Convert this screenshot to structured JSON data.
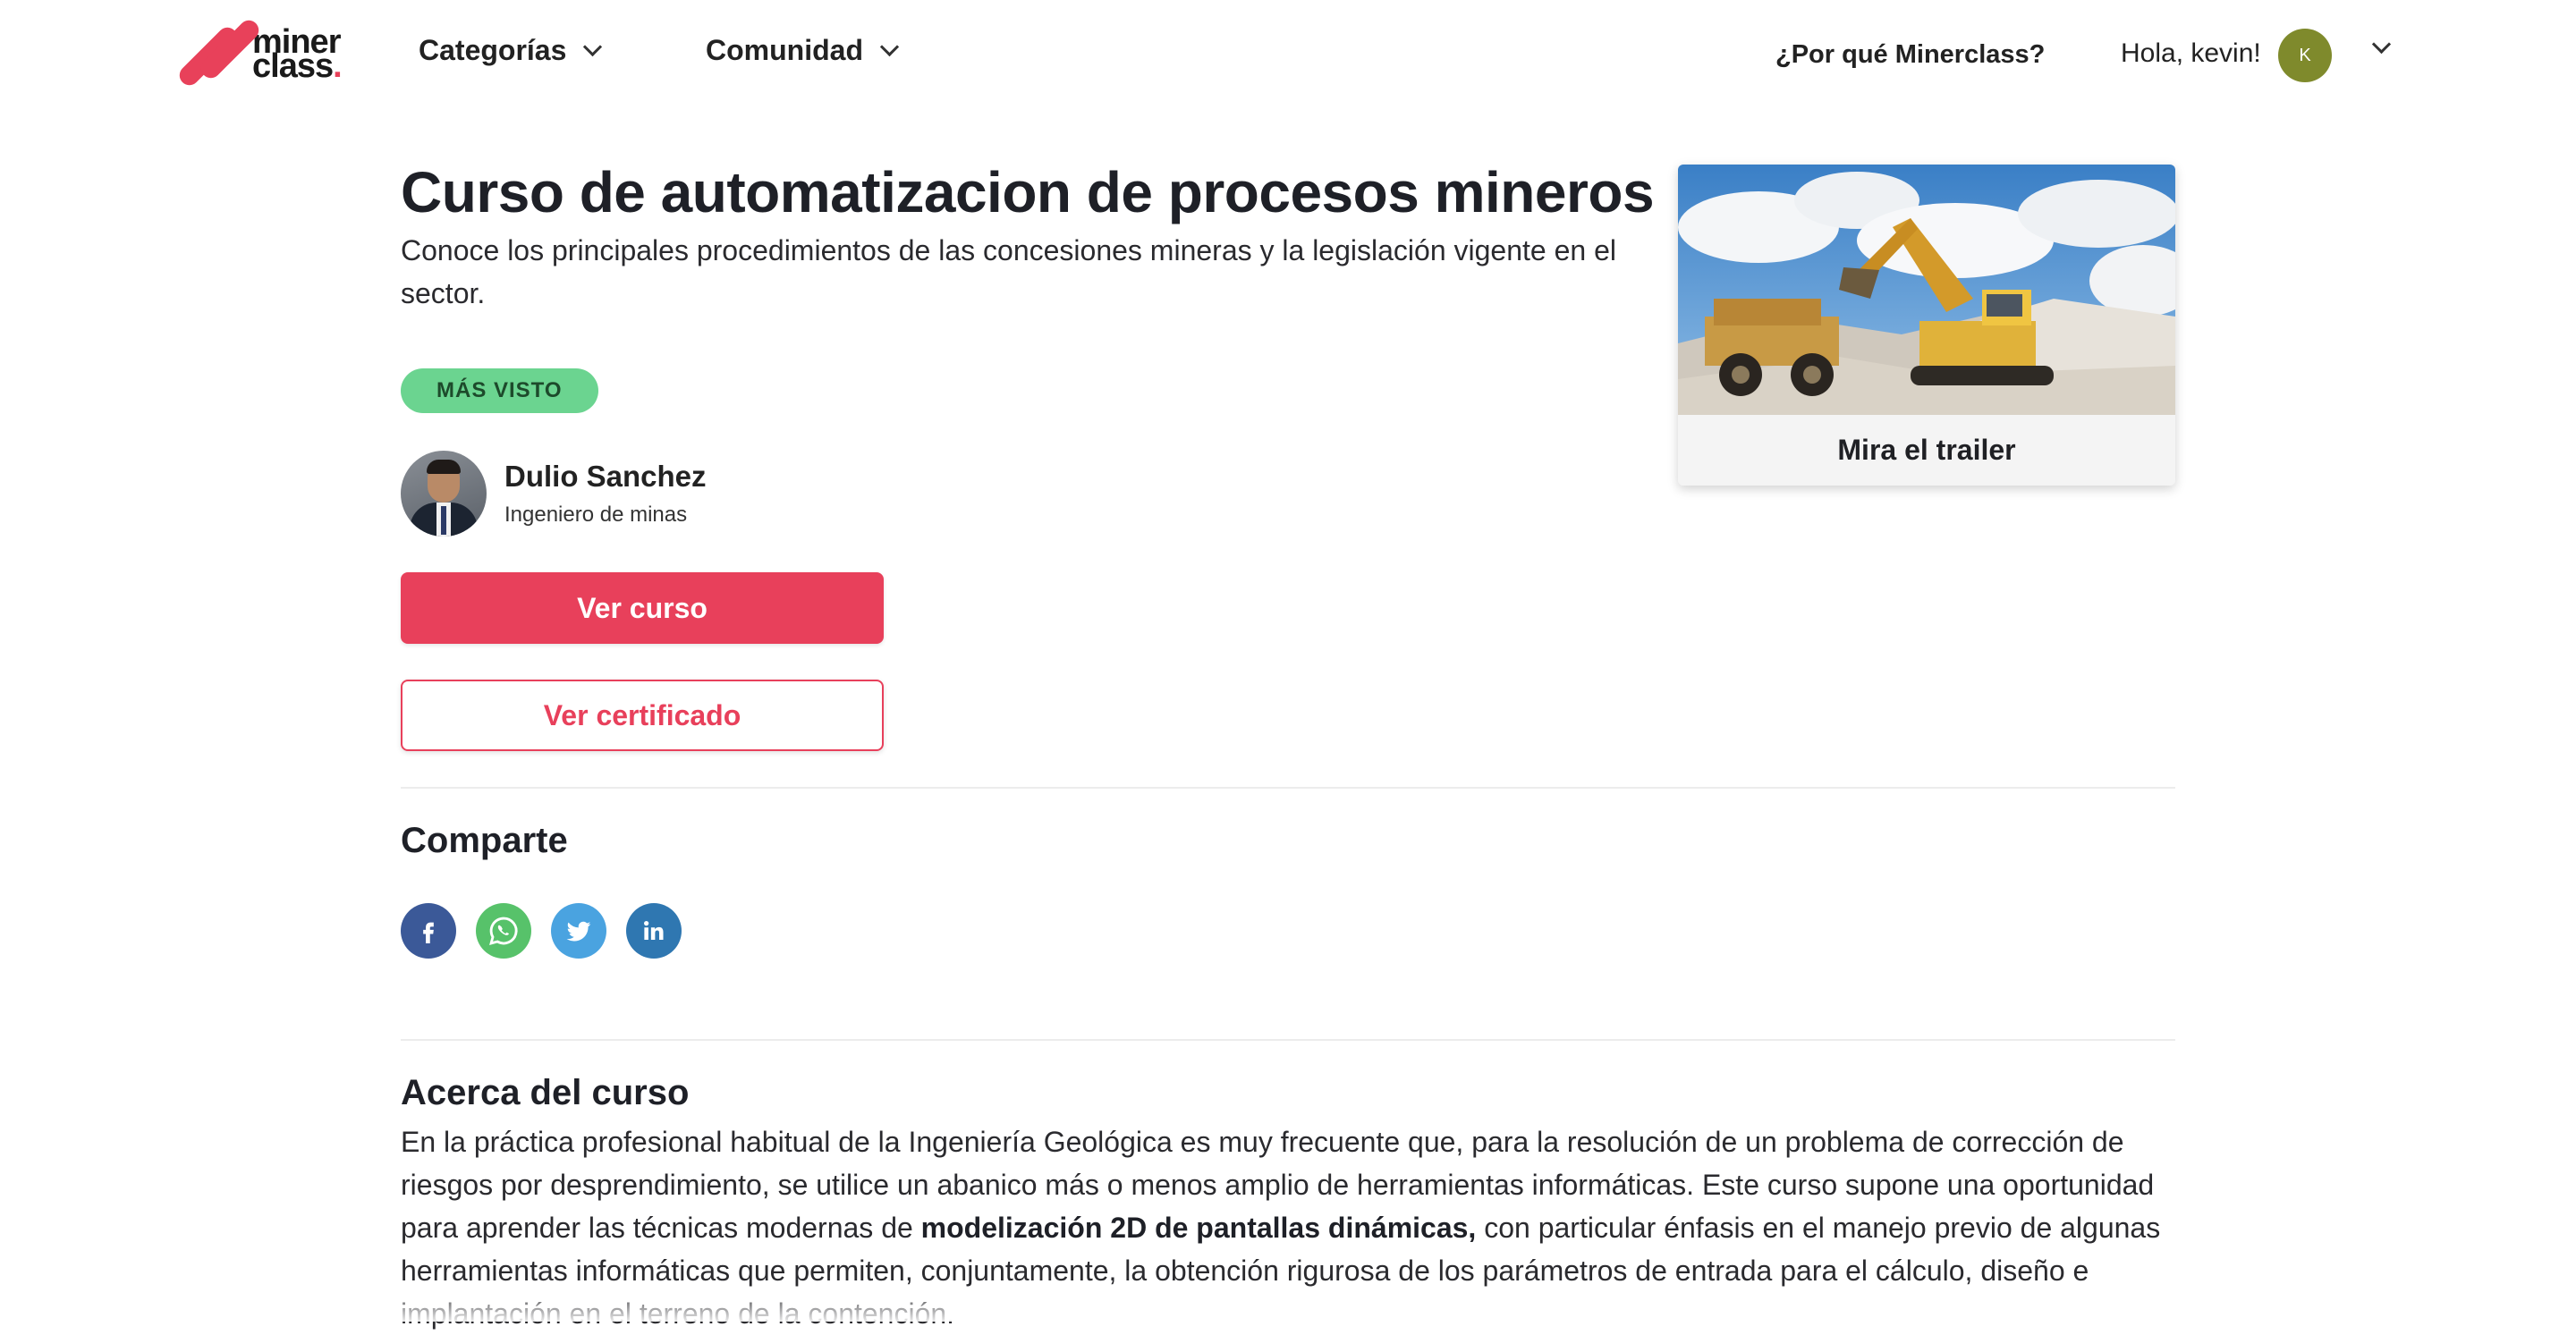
{
  "brand": {
    "logo_line1": "miner",
    "logo_line2": "class",
    "logo_dot": ".",
    "accent": "#e8415a"
  },
  "nav": {
    "categories_label": "Categorías",
    "community_label": "Comunidad",
    "why_label": "¿Por qué Minerclass?",
    "greeting": "Hola, kevin!",
    "avatar_initial": "K",
    "avatar_color": "#7f8a2c"
  },
  "course": {
    "title": "Curso de automatizacion de procesos mineros",
    "subtitle": "Conoce los principales procedimientos de las concesiones mineras y la legislación vigente en el sector.",
    "badge": "MÁS VISTO",
    "badge_color": "#6bd490",
    "instructor": {
      "name": "Dulio Sanchez",
      "role": "Ingeniero de minas"
    },
    "primary_button": "Ver curso",
    "secondary_button": "Ver certificado",
    "trailer_label": "Mira el trailer"
  },
  "share": {
    "title": "Comparte",
    "icons": [
      {
        "name": "facebook-icon",
        "color": "#3b5998"
      },
      {
        "name": "whatsapp-icon",
        "color": "#57c26a"
      },
      {
        "name": "twitter-icon",
        "color": "#4aa3e0"
      },
      {
        "name": "linkedin-icon",
        "color": "#2f77b1"
      }
    ]
  },
  "about": {
    "title": "Acerca del curso",
    "text_before": "En la práctica profesional habitual de la Ingeniería Geológica es muy frecuente que, para la resolución de un problema de corrección de riesgos por desprendimiento, se utilice un abanico más o menos amplio de herramientas informáticas. Este curso supone una oportunidad para aprender las técnicas modernas de ",
    "text_bold": "modelización 2D de pantallas dinámicas,",
    "text_after": " con particular énfasis en el manejo previo de algunas herramientas informáticas que permiten, conjuntamente, la obtención rigurosa de los parámetros de entrada para el cálculo, diseño e implantación en el terreno de la contención."
  }
}
